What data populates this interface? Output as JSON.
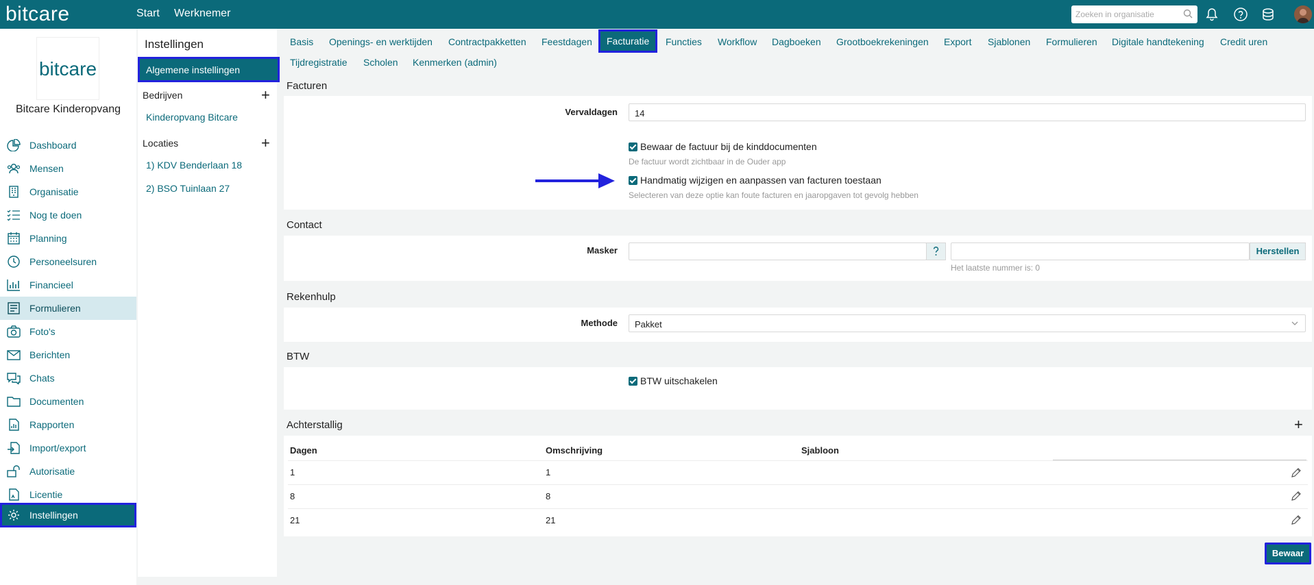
{
  "topbar": {
    "logo": "bitcare",
    "nav": [
      "Start",
      "Werknemer"
    ],
    "search_placeholder": "Zoeken in organisatie"
  },
  "org": {
    "logo_text": "bitcare",
    "name": "Bitcare Kinderopvang"
  },
  "sidebar": {
    "items": [
      {
        "label": "Dashboard",
        "icon": "dashboard-icon"
      },
      {
        "label": "Mensen",
        "icon": "people-icon"
      },
      {
        "label": "Organisatie",
        "icon": "building-icon"
      },
      {
        "label": "Nog te doen",
        "icon": "checklist-icon"
      },
      {
        "label": "Planning",
        "icon": "calendar-icon"
      },
      {
        "label": "Personeelsuren",
        "icon": "clock-icon"
      },
      {
        "label": "Financieel",
        "icon": "bar-chart-icon"
      },
      {
        "label": "Formulieren",
        "icon": "form-icon"
      },
      {
        "label": "Foto's",
        "icon": "camera-icon"
      },
      {
        "label": "Berichten",
        "icon": "envelope-icon"
      },
      {
        "label": "Chats",
        "icon": "chat-icon"
      },
      {
        "label": "Documenten",
        "icon": "folder-icon"
      },
      {
        "label": "Rapporten",
        "icon": "report-icon"
      },
      {
        "label": "Import/export",
        "icon": "import-export-icon"
      },
      {
        "label": "Autorisatie",
        "icon": "unlock-icon"
      },
      {
        "label": "Licentie",
        "icon": "license-icon"
      },
      {
        "label": "Instellingen",
        "icon": "gear-icon"
      }
    ]
  },
  "settings_nav": {
    "title": "Instellingen",
    "active": "Algemene instellingen",
    "companies_header": "Bedrijven",
    "companies": [
      "Kinderopvang Bitcare"
    ],
    "locations_header": "Locaties",
    "locations": [
      "1) KDV Benderlaan 18",
      "2) BSO Tuinlaan 27"
    ]
  },
  "tabs": {
    "row1": [
      "Basis",
      "Openings- en werktijden",
      "Contractpakketten",
      "Feestdagen",
      "Facturatie",
      "Functies",
      "Workflow",
      "Dagboeken",
      "Grootboekrekeningen",
      "Export",
      "Sjablonen",
      "Formulieren",
      "Digitale handtekening",
      "Credit uren"
    ],
    "row2": [
      "Tijdregistratie",
      "Scholen",
      "Kenmerken (admin)"
    ],
    "active": "Facturatie"
  },
  "facturen": {
    "title": "Facturen",
    "vervaldagen_label": "Vervaldagen",
    "vervaldagen_value": "14",
    "option1_label": "Bewaar de factuur bij de kinddocumenten",
    "option1_hint": "De factuur wordt zichtbaar in de Ouder app",
    "option1_checked": true,
    "option2_label": "Handmatig wijzigen en aanpassen van facturen toestaan",
    "option2_hint": "Selecteren van deze optie kan foute facturen en jaaropgaven tot gevolg hebben",
    "option2_checked": true
  },
  "contact": {
    "title": "Contact",
    "masker_label": "Masker",
    "masker_value": "",
    "nummer_value": "",
    "reset_label": "Herstellen",
    "last_number_text": "Het laatste nummer is: 0"
  },
  "rekenhulp": {
    "title": "Rekenhulp",
    "methode_label": "Methode",
    "methode_value": "Pakket"
  },
  "btw": {
    "title": "BTW",
    "option_label": "BTW uitschakelen",
    "option_checked": true
  },
  "achterstallig": {
    "title": "Achterstallig",
    "columns": [
      "Dagen",
      "Omschrijving",
      "Sjabloon"
    ],
    "rows": [
      {
        "dagen": "1",
        "omschrijving": "1",
        "sjabloon": ""
      },
      {
        "dagen": "8",
        "omschrijving": "8",
        "sjabloon": ""
      },
      {
        "dagen": "21",
        "omschrijving": "21",
        "sjabloon": ""
      }
    ]
  },
  "save_label": "Bewaar",
  "colors": {
    "brand": "#0b6a7a",
    "highlight": "#2222dd",
    "arrow": "#2222dd"
  }
}
